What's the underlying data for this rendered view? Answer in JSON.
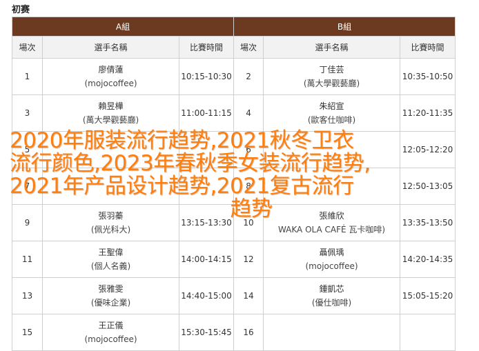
{
  "page": {
    "title": "初赛"
  },
  "groups": {
    "a": "A組",
    "b": "B組"
  },
  "headers": {
    "order": "場次",
    "player": "選手名稱",
    "time": "比賽時間"
  },
  "rows": [
    {
      "a": {
        "order": "1",
        "name": "廖倩蓮",
        "team": "(mojocoffee)",
        "time": "10:15-10:30"
      },
      "b": {
        "order": "2",
        "name": "丁佳芸",
        "team": "(萬大學觀藝廳)",
        "time": "10:35-10:50"
      }
    },
    {
      "a": {
        "order": "3",
        "name": "賴昱樺",
        "team": "(萬大學觀藝廳)",
        "time": "11:00-11:15"
      },
      "b": {
        "order": "4",
        "name": "朱紹宣",
        "team": "(歐客仕咖啡)",
        "time": "11:20-11:35"
      }
    },
    {
      "a": {
        "order": "5",
        "name": "",
        "team": "",
        "time": ""
      },
      "b": {
        "order": "6",
        "name": "",
        "team": "",
        "time": "12:05-12:20"
      }
    },
    {
      "a": {
        "order": "7",
        "name": "",
        "team": "",
        "time": ""
      },
      "b": {
        "order": "8",
        "name": "",
        "team": "",
        "time": "12:50-13:05"
      }
    },
    {
      "a": {
        "order": "9",
        "name": "張羽蓁",
        "team": "(佩光科大)",
        "time": "13:15-13:30"
      },
      "b": {
        "order": "10",
        "name": "張維欣",
        "team": "WAKA OLA CAFÉ 瓦卡咖啡)",
        "time": "13:35-13:50"
      }
    },
    {
      "a": {
        "order": "11",
        "name": "王聖偉",
        "team": "(個人名義)",
        "time": "14:00-14:15"
      },
      "b": {
        "order": "12",
        "name": "聶佩瑀",
        "team": "(mojocoffee)",
        "time": "14:20-14:35"
      }
    },
    {
      "a": {
        "order": "13",
        "name": "張雅雯",
        "team": "(優味企業)",
        "time": "14:40-15:00"
      },
      "b": {
        "order": "14",
        "name": "鍾凱芯",
        "team": "(優仕咖啡)",
        "time": "15:05-15:20"
      }
    },
    {
      "a": {
        "order": "15",
        "name": "王正儀",
        "team": "(mojocoffee)",
        "time": "15:30-15:45"
      },
      "b": {
        "order": "16",
        "name": "",
        "team": "",
        "time": ""
      }
    }
  ],
  "overlay": {
    "line1": "2020年服装流行趋势,2021秋冬卫衣",
    "line2": "流行颜色,2023年春秋季女装流行趋势,",
    "line3": "2021年产品设计趋势,2021复古流行",
    "line4": "趋势"
  },
  "colors": {
    "group_header_bg": "#6b3a21",
    "column_header_bg": "#f2f2f2",
    "overlay_text": "#ff7f0e"
  }
}
